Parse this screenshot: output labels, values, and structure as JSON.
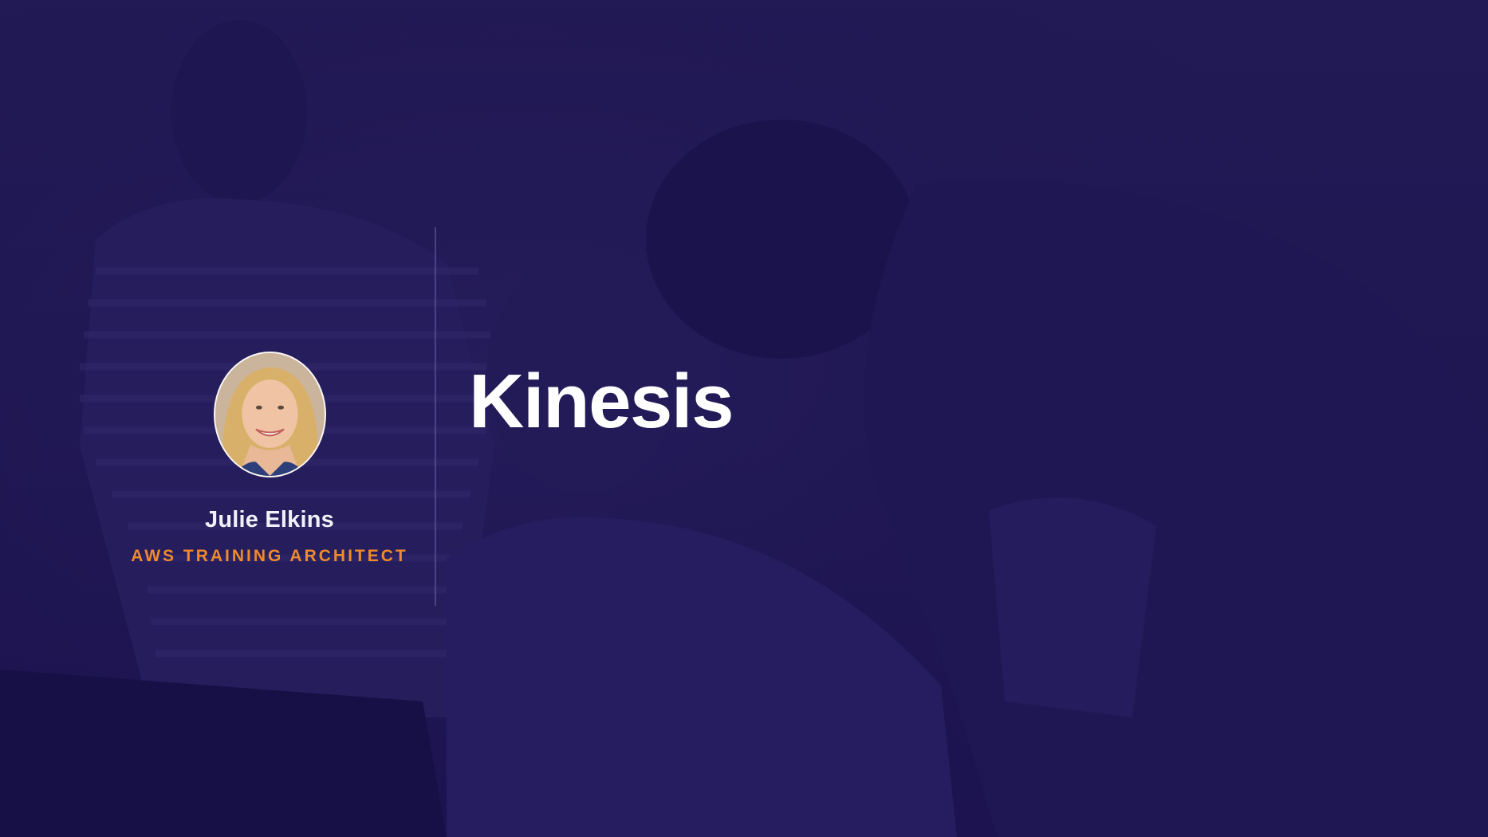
{
  "slide": {
    "title": "Kinesis",
    "background_color": "#1d1550"
  },
  "presenter": {
    "name": "Julie Elkins",
    "role": "AWS TRAINING ARCHITECT",
    "role_color": "#f08a2c"
  }
}
